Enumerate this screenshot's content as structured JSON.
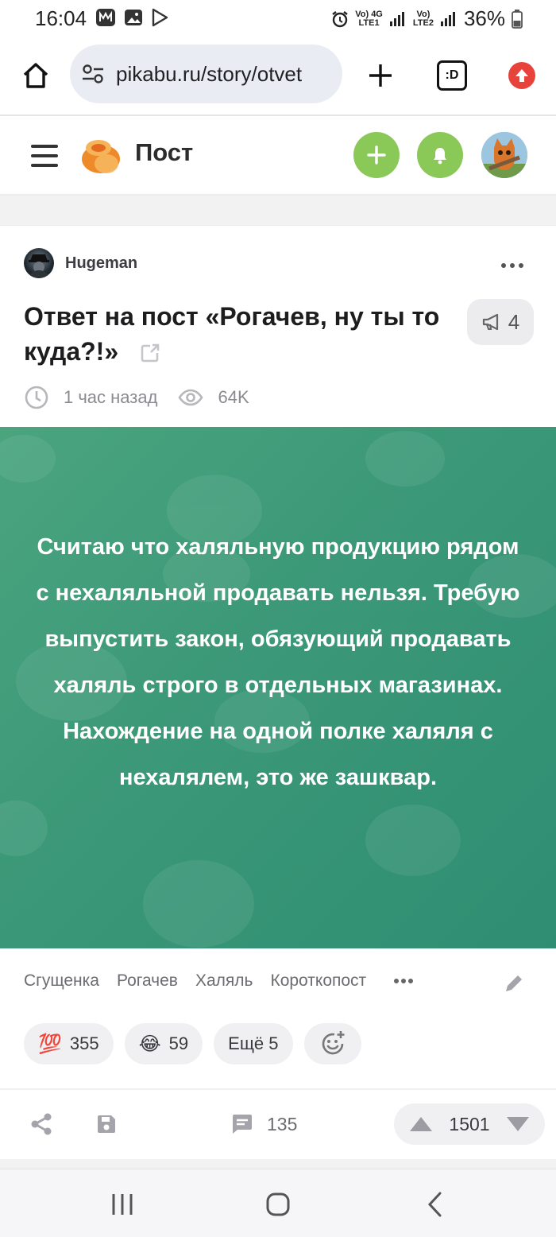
{
  "status_bar": {
    "time": "16:04",
    "network_1": "Vo) 4G",
    "network_1_sub": "LTE1",
    "network_2": "Vo)",
    "network_2_sub": "LTE2",
    "battery": "36%"
  },
  "browser": {
    "url": "pikabu.ru/story/otvet",
    "tab_count": ":D"
  },
  "site_header": {
    "title": "Пост",
    "accent_color": "#8ac858"
  },
  "post": {
    "author": "Hugeman",
    "title": "Ответ на пост «Рогачев, ну ты то куда?!»",
    "shared_count": "4",
    "time_ago": "1 час назад",
    "views": "64K",
    "body_text": "Считаю что халяльную продукцию рядом с нехаляльной продавать нельзя. Требую выпустить закон, обязующий продавать халяль строго в отдельных магазинах. Нахождение на одной полке халяля с нехалялем, это же зашквар.",
    "tags": [
      "Сгущенка",
      "Рогачев",
      "Халяль",
      "Короткопост"
    ],
    "reactions": {
      "r1_emoji": "💯",
      "r1_count": "355",
      "r2_emoji": "😂",
      "r2_count": "59",
      "more_label": "Ещё 5"
    },
    "comments": "135",
    "rating": "1501"
  },
  "icons": {
    "home": "home-icon",
    "site_settings": "tune-icon",
    "new_tab": "plus-icon",
    "tabs": "tabs-icon",
    "update": "update-icon",
    "menu": "hamburger-icon",
    "add_post": "plus-icon",
    "notifications": "bell-icon",
    "more": "more-dots-icon",
    "share": "share-icon",
    "save": "save-icon",
    "comment": "comment-icon",
    "upvote": "arrow-up-icon",
    "downvote": "arrow-down-icon",
    "edit_tags": "pencil-icon",
    "add_reaction": "smiley-plus-icon"
  }
}
